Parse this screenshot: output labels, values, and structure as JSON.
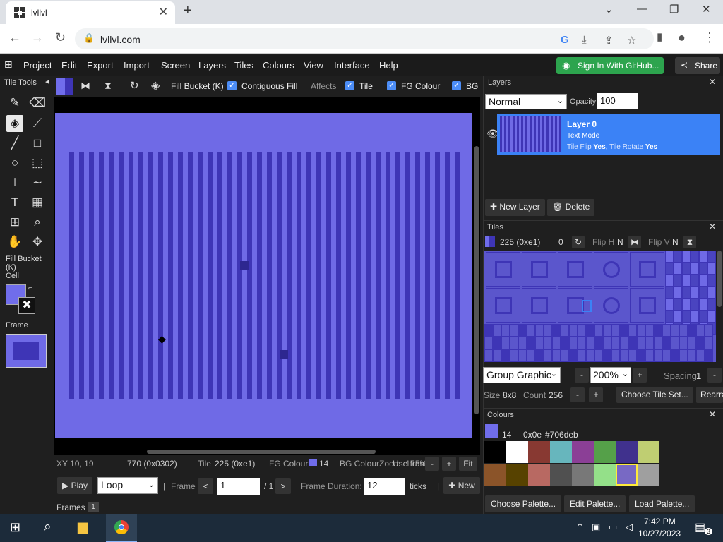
{
  "browser": {
    "tab_title": "lvllvl",
    "tab_close": "✕",
    "new_tab": "+",
    "url": "lvllvl.com",
    "win_min": "⌄",
    "win_minimize": "—",
    "win_restore": "❐",
    "win_close": "✕"
  },
  "menu": {
    "items": [
      "Project",
      "Edit",
      "Export",
      "Import",
      "Screen",
      "Layers",
      "Tiles",
      "Colours",
      "View",
      "Interface",
      "Help"
    ],
    "github": "Sign In With GitHub...",
    "share": "Share"
  },
  "tools": {
    "title": "Tile Tools",
    "current": "Fill Bucket (K)",
    "cell_label": "Cell",
    "frame_label": "Frame"
  },
  "canvas_toolbar": {
    "tool_name": "Fill Bucket (K)",
    "contiguous": "Contiguous Fill",
    "affects": "Affects",
    "tile": "Tile",
    "fg": "FG Colour",
    "bg": "BG"
  },
  "status": {
    "xy": "XY 10, 19",
    "cell_id": "770 (0x0302)",
    "tile_label": "Tile",
    "tile_value": "225 (0xe1)",
    "fg_label": "FG Colour",
    "fg_value": "14",
    "bg_label": "BG Colour",
    "zoom_overlap": "Zoom: 175%",
    "frames_overlap": "Use frames",
    "minus": "-",
    "plus": "+",
    "fit": "Fit",
    "play": "Play",
    "loop": "Loop",
    "frame_label": "Frame",
    "frame_value": "1",
    "frame_total": "/ 1",
    "duration_label": "Frame Duration:",
    "duration_value": "12",
    "ticks": "ticks",
    "new": "New",
    "frames": "Frames",
    "frames_count": "1",
    "prev": "<",
    "next": ">",
    "sep": "|"
  },
  "layers": {
    "title": "Layers",
    "blend": "Normal",
    "opacity_label": "Opacity:",
    "opacity_value": "100",
    "layer_name": "Layer 0",
    "layer_mode": "Text Mode",
    "tile_flip_label": "Tile Flip",
    "tile_flip_value": "Yes",
    "tile_rotate_label": "Tile Rotate",
    "tile_rotate_value": "Yes",
    "new_layer": "New Layer",
    "delete": "Delete"
  },
  "tiles": {
    "title": "Tiles",
    "tile_id": "225 (0xe1)",
    "rotation": "0",
    "flip_h_label": "Flip H",
    "flip_h_value": "N",
    "flip_v_label": "Flip V",
    "flip_v_value": "N",
    "group": "Group Graphic",
    "zoom": "200%",
    "minus": "-",
    "plus": "+",
    "spacing_label": "Spacing",
    "spacing_value": "1",
    "size_label": "Size",
    "size_value": "8x8",
    "count_label": "Count",
    "count_value": "256",
    "choose": "Choose Tile Set...",
    "rearrange": "Rearra"
  },
  "colours": {
    "title": "Colours",
    "index": "14",
    "hex_index": "0x0e",
    "hex": "#706deb",
    "choose": "Choose Palette...",
    "edit": "Edit Palette...",
    "load": "Load Palette...",
    "palette": [
      "#000000",
      "#ffffff",
      "#883932",
      "#67b6bd",
      "#8b3f96",
      "#55a049",
      "#40318d",
      "#bfce72",
      "#8b5429",
      "#574200",
      "#b86962",
      "#505050",
      "#787878",
      "#94e089",
      "#7869c4",
      "#9f9f9f"
    ]
  },
  "taskbar": {
    "time": "7:42 PM",
    "date": "10/27/2023",
    "notifications": "3"
  },
  "colors": {
    "canvas_bg": "#6f6ae6",
    "stripe": "#3e35b6",
    "accent": "#3b82f6",
    "github": "#2da44e"
  }
}
